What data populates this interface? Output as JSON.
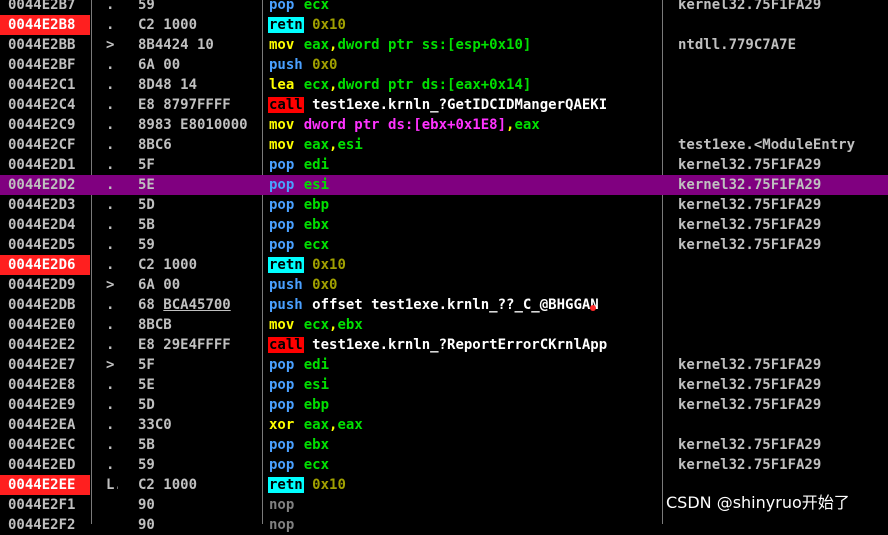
{
  "rows": [
    {
      "addr": "0044E2B7",
      "mark": ".",
      "hex": "59",
      "op": "pop",
      "opclass": "op-pop",
      "operands": [
        {
          "t": "ecx",
          "c": "t-green"
        }
      ],
      "comment": "kernel32.75F1FA29"
    },
    {
      "addr": "0044E2B8",
      "bp": true,
      "mark": ".",
      "hex": "C2 1000",
      "op": "retn",
      "opclass": "op-retn",
      "operands": [
        {
          "t": "0x10",
          "c": "t-olive"
        }
      ],
      "comment": ""
    },
    {
      "addr": "0044E2BB",
      "mark": ">",
      "hex": "8B4424 10",
      "op": "mov",
      "opclass": "op-mov",
      "operands": [
        {
          "t": "eax",
          "c": "t-green"
        },
        {
          "t": ",",
          "c": "t-yellow"
        },
        {
          "t": "dword ptr ss:[esp+0x10]",
          "c": "t-green"
        }
      ],
      "comment": "ntdll.779C7A7E"
    },
    {
      "addr": "0044E2BF",
      "mark": ".",
      "hex": "6A 00",
      "op": "push",
      "opclass": "op-push",
      "operands": [
        {
          "t": "0x0",
          "c": "t-olive"
        }
      ],
      "comment": ""
    },
    {
      "addr": "0044E2C1",
      "mark": ".",
      "hex": "8D48 14",
      "op": "lea",
      "opclass": "op-lea",
      "operands": [
        {
          "t": "ecx",
          "c": "t-green"
        },
        {
          "t": ",",
          "c": "t-yellow"
        },
        {
          "t": "dword ptr ds:[eax+0x14]",
          "c": "t-green"
        }
      ],
      "comment": ""
    },
    {
      "addr": "0044E2C4",
      "mark": ".",
      "hex": "E8 8797FFFF",
      "op": "call",
      "opclass": "op-call",
      "operands": [
        {
          "t": "test1exe.krnln_?GetIDCIDMangerQAEKI",
          "c": "t-white"
        }
      ],
      "comment": ""
    },
    {
      "addr": "0044E2C9",
      "mark": ".",
      "hex": "8983 E8010000",
      "op": "mov",
      "opclass": "op-mov",
      "operands": [
        {
          "t": "dword ptr ds:[ebx+0x1E8]",
          "c": "t-magenta"
        },
        {
          "t": ",",
          "c": "t-yellow"
        },
        {
          "t": "eax",
          "c": "t-green"
        }
      ],
      "comment": ""
    },
    {
      "addr": "0044E2CF",
      "mark": ".",
      "hex": "8BC6",
      "op": "mov",
      "opclass": "op-mov",
      "operands": [
        {
          "t": "eax",
          "c": "t-green"
        },
        {
          "t": ",",
          "c": "t-yellow"
        },
        {
          "t": "esi",
          "c": "t-green"
        }
      ],
      "comment": "test1exe.<ModuleEntry"
    },
    {
      "addr": "0044E2D1",
      "mark": ".",
      "hex": "5F",
      "op": "pop",
      "opclass": "op-pop",
      "operands": [
        {
          "t": "edi",
          "c": "t-green"
        }
      ],
      "comment": "kernel32.75F1FA29"
    },
    {
      "addr": "0044E2D2",
      "sel": true,
      "mark": ".",
      "hex": "5E",
      "op": "pop",
      "opclass": "op-pop",
      "operands": [
        {
          "t": "esi",
          "c": "t-green"
        }
      ],
      "comment": "kernel32.75F1FA29"
    },
    {
      "addr": "0044E2D3",
      "mark": ".",
      "hex": "5D",
      "op": "pop",
      "opclass": "op-pop",
      "operands": [
        {
          "t": "ebp",
          "c": "t-green"
        }
      ],
      "comment": "kernel32.75F1FA29"
    },
    {
      "addr": "0044E2D4",
      "mark": ".",
      "hex": "5B",
      "op": "pop",
      "opclass": "op-pop",
      "operands": [
        {
          "t": "ebx",
          "c": "t-green"
        }
      ],
      "comment": "kernel32.75F1FA29"
    },
    {
      "addr": "0044E2D5",
      "mark": ".",
      "hex": "59",
      "op": "pop",
      "opclass": "op-pop",
      "operands": [
        {
          "t": "ecx",
          "c": "t-green"
        }
      ],
      "comment": "kernel32.75F1FA29"
    },
    {
      "addr": "0044E2D6",
      "bp": true,
      "mark": ".",
      "hex": "C2 1000",
      "op": "retn",
      "opclass": "op-retn",
      "operands": [
        {
          "t": "0x10",
          "c": "t-olive"
        }
      ],
      "comment": ""
    },
    {
      "addr": "0044E2D9",
      "mark": ">",
      "hex": "6A 00",
      "op": "push",
      "opclass": "op-push",
      "operands": [
        {
          "t": "0x0",
          "c": "t-olive"
        }
      ],
      "comment": ""
    },
    {
      "addr": "0044E2DB",
      "mark": ".",
      "hex": "68 ",
      "hexul": "BCA45700",
      "op": "push",
      "opclass": "op-push",
      "operands": [
        {
          "t": "offset test1exe.krnln_??_C_@BHGGAN",
          "c": "t-white"
        }
      ],
      "comment": ""
    },
    {
      "addr": "0044E2E0",
      "mark": ".",
      "hex": "8BCB",
      "op": "mov",
      "opclass": "op-mov",
      "operands": [
        {
          "t": "ecx",
          "c": "t-green"
        },
        {
          "t": ",",
          "c": "t-yellow"
        },
        {
          "t": "ebx",
          "c": "t-green"
        }
      ],
      "comment": ""
    },
    {
      "addr": "0044E2E2",
      "mark": ".",
      "hex": "E8 29E4FFFF",
      "op": "call",
      "opclass": "op-call",
      "operands": [
        {
          "t": "test1exe.krnln_?ReportErrorCKrnlApp",
          "c": "t-white"
        }
      ],
      "comment": ""
    },
    {
      "addr": "0044E2E7",
      "mark": ">",
      "hex": "5F",
      "op": "pop",
      "opclass": "op-pop",
      "operands": [
        {
          "t": "edi",
          "c": "t-green"
        }
      ],
      "comment": "kernel32.75F1FA29"
    },
    {
      "addr": "0044E2E8",
      "mark": ".",
      "hex": "5E",
      "op": "pop",
      "opclass": "op-pop",
      "operands": [
        {
          "t": "esi",
          "c": "t-green"
        }
      ],
      "comment": "kernel32.75F1FA29"
    },
    {
      "addr": "0044E2E9",
      "mark": ".",
      "hex": "5D",
      "op": "pop",
      "opclass": "op-pop",
      "operands": [
        {
          "t": "ebp",
          "c": "t-green"
        }
      ],
      "comment": "kernel32.75F1FA29"
    },
    {
      "addr": "0044E2EA",
      "mark": ".",
      "hex": "33C0",
      "op": "xor",
      "opclass": "op-xor",
      "operands": [
        {
          "t": "eax",
          "c": "t-green"
        },
        {
          "t": ",",
          "c": "t-yellow"
        },
        {
          "t": "eax",
          "c": "t-green"
        }
      ],
      "comment": ""
    },
    {
      "addr": "0044E2EC",
      "mark": ".",
      "hex": "5B",
      "op": "pop",
      "opclass": "op-pop",
      "operands": [
        {
          "t": "ebx",
          "c": "t-green"
        }
      ],
      "comment": "kernel32.75F1FA29"
    },
    {
      "addr": "0044E2ED",
      "mark": ".",
      "hex": "59",
      "op": "pop",
      "opclass": "op-pop",
      "operands": [
        {
          "t": "ecx",
          "c": "t-green"
        }
      ],
      "comment": "kernel32.75F1FA29"
    },
    {
      "addr": "0044E2EE",
      "bp": true,
      "mark": "L.",
      "hex": "C2 1000",
      "op": "retn",
      "opclass": "op-retn",
      "operands": [
        {
          "t": "0x10",
          "c": "t-olive"
        }
      ],
      "comment": ""
    },
    {
      "addr": "0044E2F1",
      "mark": "",
      "hex": "90",
      "op": "nop",
      "opclass": "op-nop",
      "operands": [],
      "comment": ""
    },
    {
      "addr": "0044E2F2",
      "mark": "",
      "hex": "90",
      "op": "nop",
      "opclass": "op-nop",
      "operands": [],
      "comment": ""
    }
  ],
  "watermark": "CSDN @shinyruo开始了"
}
